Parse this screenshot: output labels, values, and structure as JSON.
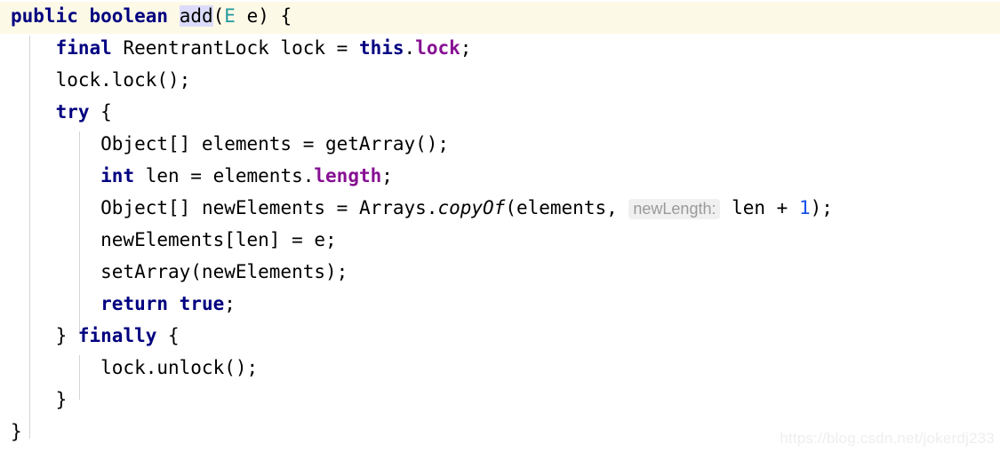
{
  "editor": {
    "language": "java",
    "theme": "IntelliJ Light",
    "colors": {
      "background": "#ffffff",
      "caret_row": "#fdf9e7",
      "keyword": "#000080",
      "field": "#871094",
      "type_parameter": "#20999d",
      "number": "#1750eb",
      "identifier_under_caret": "#dcdcfa",
      "indent_guide": "#d4d4d4",
      "param_hint_text": "#9a9a9a",
      "param_hint_bg": "#f0f0f0",
      "watermark": "#eeeeee"
    }
  },
  "code": {
    "line1": {
      "kw_public": "public",
      "sp1": " ",
      "kw_boolean": "boolean",
      "sp2": " ",
      "ident_add": "add",
      "paren_open": "(",
      "typeparam_E": "E",
      "arg_e": " e",
      "tail": ") {"
    },
    "line2": {
      "indent": "    ",
      "kw_final": "final",
      "mid": " ReentrantLock lock = ",
      "kw_this": "this",
      "dot": ".",
      "field_lock": "lock",
      "tail": ";"
    },
    "line3": {
      "text": "    lock.lock();"
    },
    "line4": {
      "indent": "    ",
      "kw_try": "try",
      "tail": " {"
    },
    "line5": {
      "text": "        Object[] elements = getArray();"
    },
    "line6": {
      "indent": "        ",
      "kw_int": "int",
      "mid": " len = elements.",
      "field_length": "length",
      "tail": ";"
    },
    "line7": {
      "indent": "        ",
      "pre": "Object[] newElements = Arrays.",
      "static_copyOf": "copyOf",
      "args_open": "(elements, ",
      "param_hint": "newLength:",
      "mid": " len + ",
      "num_one": "1",
      "tail": ");"
    },
    "line8": {
      "text": "        newElements[len] = e;"
    },
    "line9": {
      "text": "        setArray(newElements);"
    },
    "line10": {
      "indent": "        ",
      "kw_return": "return",
      "sp": " ",
      "kw_true": "true",
      "tail": ";"
    },
    "line11": {
      "indent": "    ",
      "brace": "} ",
      "kw_finally": "finally",
      "tail": " {"
    },
    "line12": {
      "text": "        lock.unlock();"
    },
    "line13": {
      "text": "    }"
    },
    "line14": {
      "text": "}"
    }
  },
  "watermark": {
    "text": "https://blog.csdn.net/jokerdj233"
  }
}
